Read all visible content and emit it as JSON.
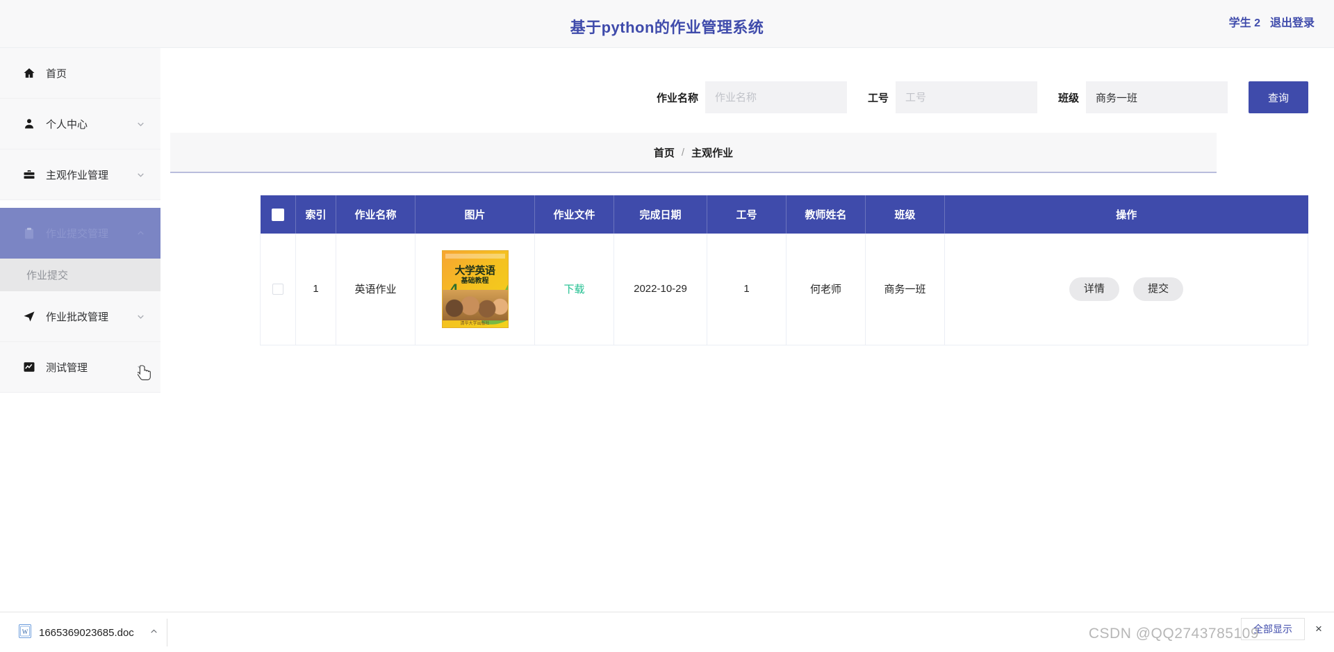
{
  "header": {
    "title": "基于python的作业管理系统",
    "user": "学生 2",
    "logout": "退出登录"
  },
  "sidebar": {
    "items": [
      {
        "label": "首页",
        "icon": "home-icon",
        "arrow": "",
        "active": false
      },
      {
        "label": "个人中心",
        "icon": "user-icon",
        "arrow": "chevron-down-icon",
        "active": false
      },
      {
        "label": "主观作业管理",
        "icon": "briefcase-icon",
        "arrow": "chevron-down-icon",
        "active": false
      },
      {
        "label": "作业提交管理",
        "icon": "clipboard-icon",
        "arrow": "chevron-up-icon",
        "active": true
      },
      {
        "label": "作业批改管理",
        "icon": "send-icon",
        "arrow": "chevron-down-icon",
        "active": false
      },
      {
        "label": "测试管理",
        "icon": "chart-icon",
        "arrow": "chevron-down-icon",
        "active": false
      }
    ],
    "submenu": [
      {
        "label": "作业提交"
      }
    ]
  },
  "search": {
    "fields": [
      {
        "label": "作业名称",
        "value": "",
        "placeholder": "作业名称",
        "name": "homework-name"
      },
      {
        "label": "工号",
        "value": "",
        "placeholder": "工号",
        "name": "staff-id"
      },
      {
        "label": "班级",
        "value": "商务一班",
        "placeholder": "班级",
        "name": "class"
      }
    ],
    "button": "查询"
  },
  "breadcrumb": {
    "home": "首页",
    "separator": "/",
    "current": "主观作业"
  },
  "table": {
    "columns": [
      "",
      "索引",
      "作业名称",
      "图片",
      "作业文件",
      "完成日期",
      "工号",
      "教师姓名",
      "班级",
      "操作"
    ],
    "rows": [
      {
        "index": "1",
        "homework_name": "英语作业",
        "image_alt": "大学英语基础教程 4",
        "file_link": "下载",
        "finish_date": "2022-10-29",
        "staff_id": "1",
        "teacher_name": "何老师",
        "class_name": "商务一班",
        "actions": [
          "详情",
          "提交"
        ]
      }
    ],
    "book_cover": {
      "line1": "大学英语",
      "line2": "基础教程",
      "number": "4",
      "publisher": "清华大学出版社"
    }
  },
  "download_bar": {
    "file_name": "1665369023685.doc",
    "file_icon": "word-doc-icon",
    "caret": "chevron-up-icon",
    "show_all": "全部显示",
    "close": "×"
  },
  "watermark": "CSDN @QQ2743785109",
  "colors": {
    "brand": "#3f4bab",
    "active_menu": "#7b85c4",
    "active_strip": "#4c59a7",
    "link_green": "#1fbf8f",
    "panel_bg": "#f8f8f9"
  }
}
